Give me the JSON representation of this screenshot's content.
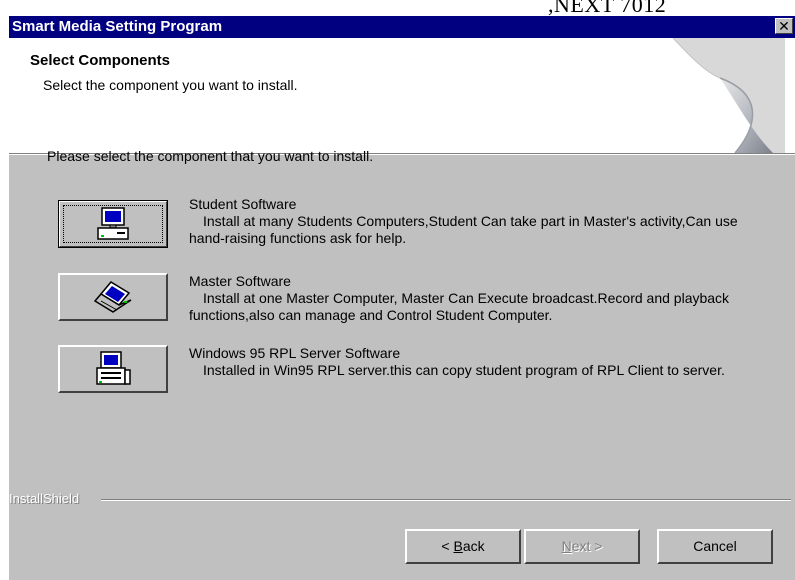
{
  "overlay_text": ",NEXT 7012",
  "window": {
    "title": "Smart Media Setting Program",
    "close_glyph": "✕"
  },
  "header": {
    "title": "Select Components",
    "subtitle": "Select the component you want to install."
  },
  "instruction": "Please select the component that you want to install.",
  "components": [
    {
      "name": "Student Software",
      "description": "Install at many Students Computers,Student Can take part in Master's activity,Can use hand-raising functions ask for help.",
      "icon": "desktop-computer-icon"
    },
    {
      "name": "Master Software",
      "description": "Install at one Master Computer, Master Can Execute broadcast.Record and playback functions,also can manage and Control Student Computer.",
      "icon": "laptop-icon"
    },
    {
      "name": "Windows 95 RPL Server Software",
      "description": "Installed in Win95 RPL server.this can copy student program of RPL Client to server.",
      "icon": "server-computer-icon"
    }
  ],
  "footer": {
    "brand": "InstallShield",
    "back": {
      "prefix": "< ",
      "accel": "B",
      "rest": "ack"
    },
    "next": {
      "accel": "N",
      "rest": "ext >"
    },
    "cancel": "Cancel"
  },
  "colors": {
    "titlebar": "#000080",
    "dialog_face": "#c0c0c0",
    "header_bg": "#ffffff",
    "disabled_text": "#808080"
  }
}
